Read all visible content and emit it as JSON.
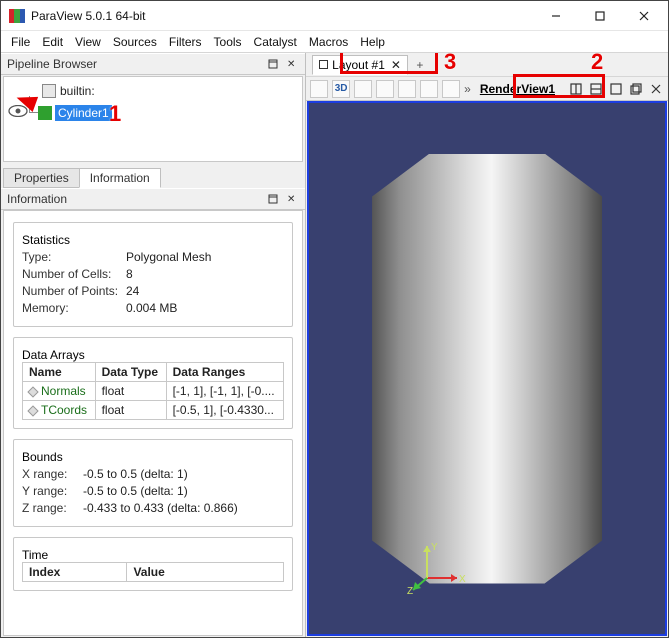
{
  "titlebar": {
    "title": "ParaView 5.0.1 64-bit"
  },
  "menubar": [
    "File",
    "Edit",
    "View",
    "Sources",
    "Filters",
    "Tools",
    "Catalyst",
    "Macros",
    "Help"
  ],
  "pipeline": {
    "title": "Pipeline Browser",
    "server": "builtin:",
    "node": "Cylinder1"
  },
  "tabs": {
    "properties": "Properties",
    "information": "Information"
  },
  "infoHeader": "Information",
  "stats": {
    "title": "Statistics",
    "type_k": "Type:",
    "type_v": "Polygonal Mesh",
    "cells_k": "Number of Cells:",
    "cells_v": "8",
    "points_k": "Number of Points:",
    "points_v": "24",
    "memory_k": "Memory:",
    "memory_v": "0.004 MB"
  },
  "arrays": {
    "title": "Data Arrays",
    "h1": "Name",
    "h2": "Data Type",
    "h3": "Data Ranges",
    "r1": {
      "name": "Normals",
      "type": "float",
      "range": "[-1, 1], [-1, 1], [-0...."
    },
    "r2": {
      "name": "TCoords",
      "type": "float",
      "range": "[-0.5, 1], [-0.4330..."
    }
  },
  "bounds": {
    "title": "Bounds",
    "x": "X range:",
    "xv": "-0.5 to 0.5 (delta: 1)",
    "y": "Y range:",
    "yv": "-0.5 to 0.5 (delta: 1)",
    "z": "Z range:",
    "zv": "-0.433 to 0.433 (delta: 0.866)"
  },
  "time": {
    "title": "Time",
    "h1": "Index",
    "h2": "Value"
  },
  "layout": {
    "tab": "Layout #1"
  },
  "toolRight": {
    "threeD": "3D",
    "render": "RenderView1"
  },
  "callouts": {
    "n1": "1",
    "n2": "2",
    "n3": "3"
  },
  "axes": {
    "x": "X",
    "y": "Y",
    "z": "Z"
  }
}
